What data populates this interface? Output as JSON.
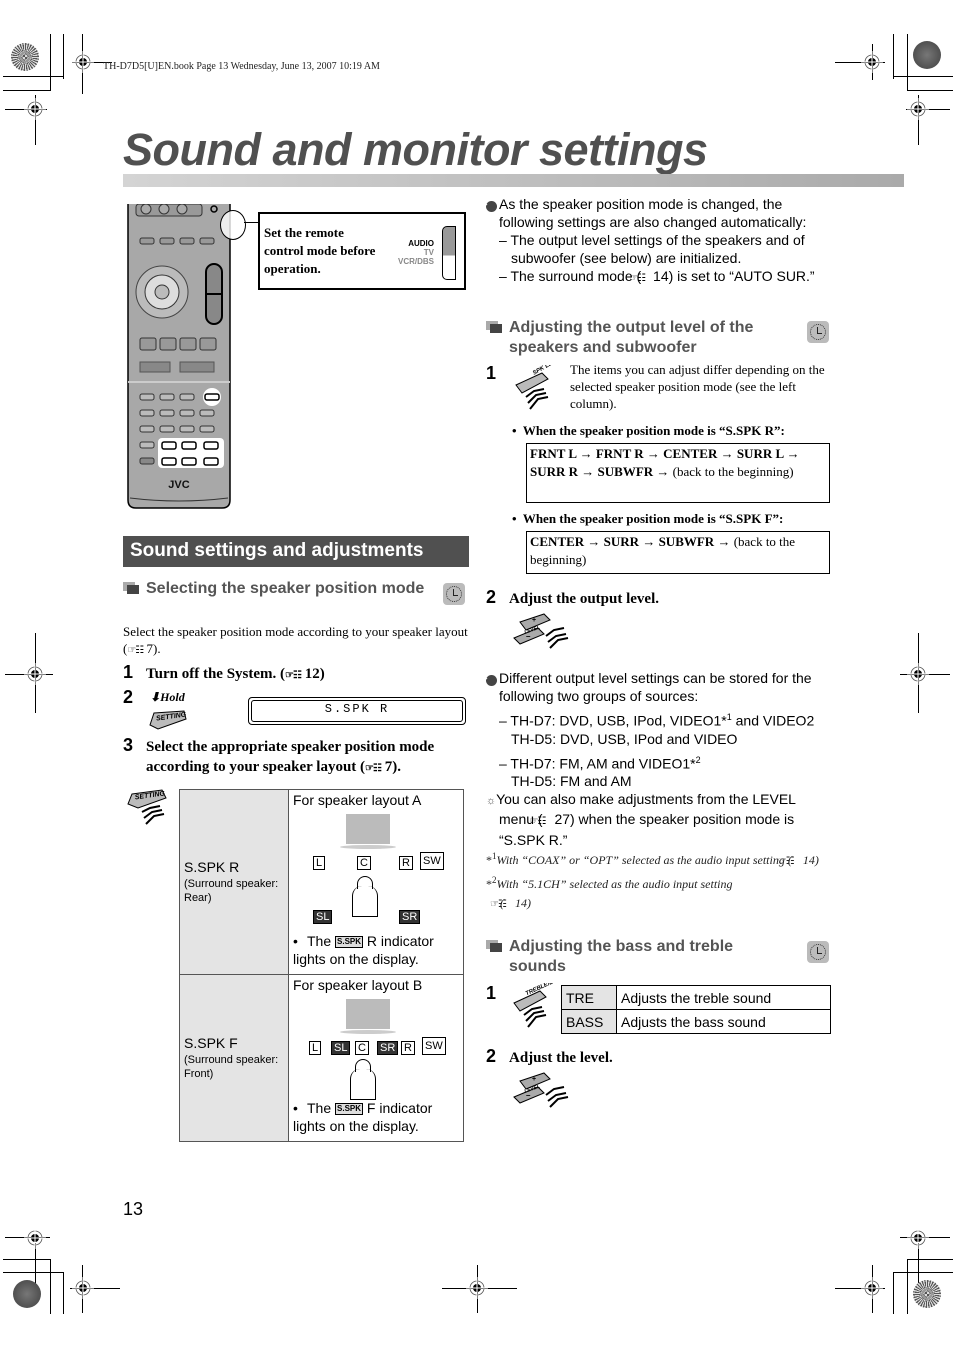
{
  "book_header": "TH-D7D5[U]EN.book  Page 13  Wednesday, June 13, 2007  10:19 AM",
  "page_title": "Sound and monitor settings",
  "remote": {
    "brand": "JVC",
    "callout": "Set the remote control mode before operation.",
    "mode_labels": [
      "AUDIO",
      "TV",
      "VCR/DBS"
    ]
  },
  "left": {
    "section_banner": "Sound settings and adjustments",
    "subhead": "Selecting the speaker position mode",
    "intro": "Select the speaker position mode according to your speaker layout (",
    "intro_ref": "7).",
    "steps": [
      {
        "num": "1",
        "text": "Turn off the System. (",
        "ref": "12)"
      },
      {
        "num": "2",
        "hold": "Hold",
        "button": "SETTING",
        "display": "S.SPK R"
      },
      {
        "num": "3",
        "text": "Select the appropriate speaker position mode according to your speaker layout (",
        "ref": "7)."
      }
    ],
    "table": {
      "button": "SETTING",
      "rows": [
        {
          "mode": "S.SPK R",
          "sub": "(Surround speaker: Rear)",
          "layout_title": "For speaker layout A",
          "speakers_front": [
            "L",
            "C",
            "R",
            "SW"
          ],
          "speakers_rear": [
            "SL",
            "SR"
          ],
          "note_prefix": "The",
          "indicator": "S.SPK",
          "note_suffix": "R indicator lights on the display."
        },
        {
          "mode": "S.SPK F",
          "sub": "(Surround speaker: Front)",
          "layout_title": "For speaker layout B",
          "speakers_front": [
            "L",
            "SL",
            "C",
            "SR",
            "R",
            "SW"
          ],
          "note_prefix": "The",
          "indicator": "S.SPK",
          "note_suffix": "F indicator lights on the display."
        }
      ]
    }
  },
  "right": {
    "note1": {
      "text": "As the speaker position mode is changed, the following settings are also changed automatically:",
      "items": [
        "The output level settings of the speakers and of subwoofer (see below) are initialized.",
        "The surround mode (",
        "14) is set to “AUTO SUR.”"
      ]
    },
    "subhead1": "Adjusting the output level of the speakers and subwoofer",
    "step1": {
      "num": "1",
      "button": "SPK LEVEL",
      "text": "The items you can adjust differ depending on the selected speaker position mode (see the left column).",
      "cond_r": "When the speaker position mode is “S.SPK R”:",
      "seq_r": "FRNT L → FRNT R → CENTER → SURR L → SURR R → SUBWFR →",
      "seq_r_tail": "(back to the beginning)",
      "cond_f": "When the speaker position mode is “S.SPK F”:",
      "seq_f": "CENTER → SURR → SUBWFR →",
      "seq_f_tail": "(back to the beginning)"
    },
    "step2": {
      "num": "2",
      "text": "Adjust the output level.",
      "button": "LEVEL"
    },
    "note2": {
      "text": "Different output level settings can be stored for the following two groups of sources:",
      "groups": [
        {
          "line1": "– TH-D7:  DVD, USB, IPod, VIDEO1*",
          "sup1": "1",
          "line1_tail": " and VIDEO2",
          "line2": "TH-D5:  DVD, USB, IPod and VIDEO"
        },
        {
          "line1": "– TH-D7:  FM, AM and VIDEO1*",
          "sup1": "2",
          "line1_tail": "",
          "line2": "TH-D5:  FM and AM"
        }
      ]
    },
    "tip": {
      "text1": "You can also make adjustments from the LEVEL menu (",
      "text2": "27) when the speaker position mode is “S.SPK R.”"
    },
    "footnotes": [
      {
        "mark": "*",
        "sup": "1",
        "text": "With “COAX” or “OPT” selected as the audio input setting",
        "ref": "14)"
      },
      {
        "mark": "*",
        "sup": "2",
        "text": "With “5.1CH” selected as the audio input setting",
        "ref": "14)"
      }
    ],
    "subhead2": "Adjusting the bass and treble sounds",
    "step3": {
      "num": "1",
      "button": "TREBLE/BASS",
      "table": [
        {
          "key": "TRE",
          "value": "Adjusts the treble sound"
        },
        {
          "key": "BASS",
          "value": "Adjusts the bass sound"
        }
      ]
    },
    "step4": {
      "num": "2",
      "text": "Adjust the level.",
      "button": "LEVEL"
    }
  },
  "ref_symbol": "☞☷",
  "page_number": "13"
}
